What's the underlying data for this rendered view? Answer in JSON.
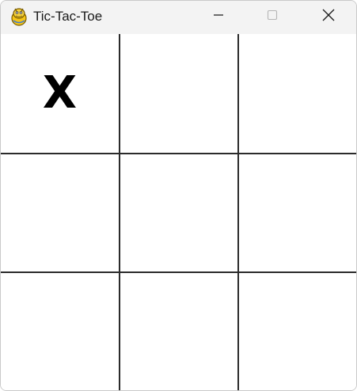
{
  "window": {
    "title": "Tic-Tac-Toe",
    "app_icon": "pygame-snake-icon",
    "controls": {
      "minimize_icon": "minimize-icon",
      "maximize_icon": "maximize-icon",
      "close_icon": "close-icon"
    }
  },
  "board": {
    "cells": [
      {
        "mark": "X"
      },
      {
        "mark": ""
      },
      {
        "mark": ""
      },
      {
        "mark": ""
      },
      {
        "mark": ""
      },
      {
        "mark": ""
      },
      {
        "mark": ""
      },
      {
        "mark": ""
      },
      {
        "mark": ""
      }
    ],
    "line_color": "#2b2b2b",
    "background": "#ffffff",
    "mark_color": "#000000"
  }
}
